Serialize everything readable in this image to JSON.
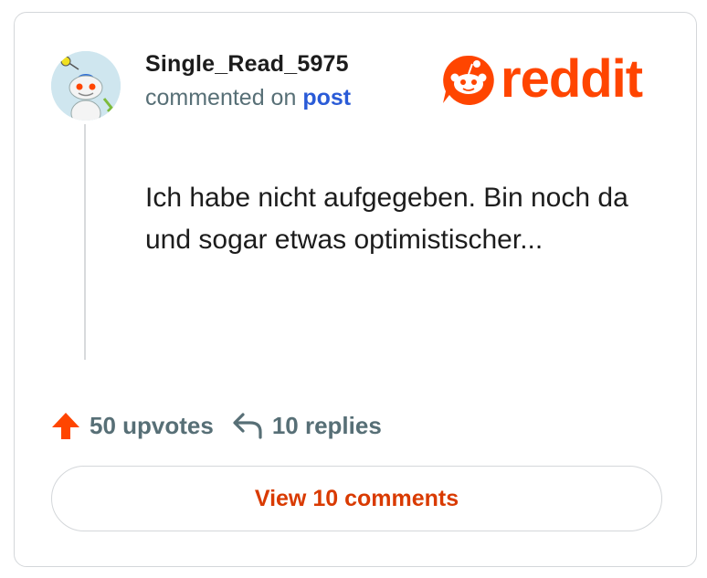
{
  "comment": {
    "username": "Single_Read_5975",
    "subline_text": "commented on",
    "subline_link": "post",
    "body": "Ich habe nicht aufgegeben. Bin noch da und sogar etwas optimistischer..."
  },
  "logo": {
    "word": "reddit",
    "icon": "reddit-snoo-icon",
    "color": "#ff4500"
  },
  "actions": {
    "upvotes_label": "50 upvotes",
    "upvote_icon": "arrow-up-icon",
    "replies_label": "10 replies",
    "reply_icon": "reply-arrow-icon"
  },
  "button": {
    "view_comments_label": "View 10 comments"
  },
  "colors": {
    "accent": "#ff4500",
    "button_text": "#d93a00",
    "link": "#2a5bd7",
    "muted": "#576f76"
  }
}
